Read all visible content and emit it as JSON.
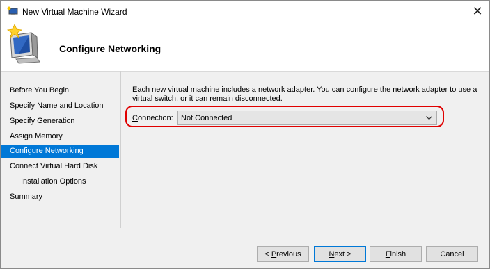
{
  "window": {
    "title": "New Virtual Machine Wizard",
    "close_glyph": "✕"
  },
  "header": {
    "title": "Configure Networking",
    "icon": "computer-sparkle-icon"
  },
  "nav": {
    "items": [
      {
        "label": "Before You Begin",
        "active": false,
        "sub": false
      },
      {
        "label": "Specify Name and Location",
        "active": false,
        "sub": false
      },
      {
        "label": "Specify Generation",
        "active": false,
        "sub": false
      },
      {
        "label": "Assign Memory",
        "active": false,
        "sub": false
      },
      {
        "label": "Configure Networking",
        "active": true,
        "sub": false
      },
      {
        "label": "Connect Virtual Hard Disk",
        "active": false,
        "sub": false
      },
      {
        "label": "Installation Options",
        "active": false,
        "sub": true
      },
      {
        "label": "Summary",
        "active": false,
        "sub": false
      }
    ]
  },
  "main": {
    "description_line1": "Each new virtual machine includes a network adapter. You can configure the network adapter to use a",
    "description_line2": "virtual switch, or it can remain disconnected.",
    "connection": {
      "label_key": "C",
      "label_rest": "onnection:",
      "value": "Not Connected"
    }
  },
  "buttons": {
    "previous": {
      "prefix": "< ",
      "key": "P",
      "rest": "revious"
    },
    "next": {
      "key": "N",
      "rest": "ext >"
    },
    "finish": {
      "key": "F",
      "rest": "inish"
    },
    "cancel": "Cancel"
  },
  "colors": {
    "accent": "#0078d7",
    "highlight": "#e00000"
  }
}
